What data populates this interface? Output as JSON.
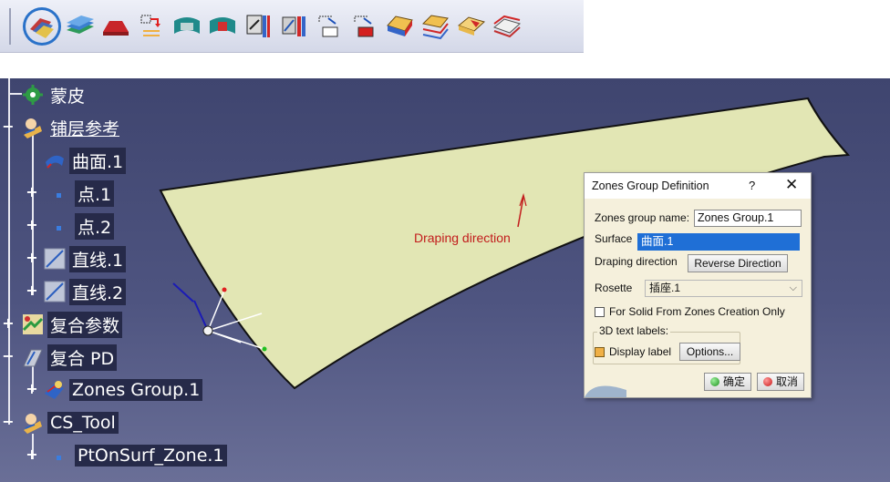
{
  "toolbar": {
    "icons": [
      "composites-design-icon",
      "layered-plies-icon",
      "stacking-icon",
      "transfer-icon",
      "zone-group-icon",
      "zone-icon",
      "rosette-icon",
      "ply-group-icon",
      "copy-plies-icon",
      "paste-plies-icon",
      "solid-slicing-icon",
      "explode-plies-icon",
      "core-sampling-icon",
      "export-plies-icon"
    ],
    "active_index": 0
  },
  "tree": {
    "items": [
      {
        "label": "蒙皮",
        "icon": "gear-settings-icon"
      },
      {
        "label": "铺层参考",
        "icon": "reference-icon",
        "underlined": true
      },
      {
        "label": "曲面.1",
        "icon": "surface-icon"
      },
      {
        "label": "点.1",
        "icon": "point-icon"
      },
      {
        "label": "点.2",
        "icon": "point-icon"
      },
      {
        "label": "直线.1",
        "icon": "line-icon"
      },
      {
        "label": "直线.2",
        "icon": "line-icon"
      },
      {
        "label": "复合参数",
        "icon": "composites-parameters-icon"
      },
      {
        "label": "复合 PD",
        "icon": "composites-pd-icon"
      },
      {
        "label": "Zones Group.1",
        "icon": "zones-group-icon"
      },
      {
        "label": "CS_Tool",
        "icon": "reference-icon"
      },
      {
        "label": "PtOnSurf_Zone.1",
        "icon": "point-icon"
      }
    ]
  },
  "viewport": {
    "draping_label": "Draping direction"
  },
  "dialog": {
    "title": "Zones Group Definition",
    "help": "?",
    "close": "✕",
    "zones_group_name_label": "Zones group name:",
    "zones_group_name_value": "Zones Group.1",
    "surface_label": "Surface",
    "surface_value": "曲面.1",
    "draping_direction_label": "Draping direction",
    "reverse_direction_button": "Reverse Direction",
    "rosette_label": "Rosette",
    "rosette_value": "插座.1",
    "solid_checkbox_label": "For Solid From Zones Creation Only",
    "solid_checkbox_checked": false,
    "text_labels_group": "3D text labels:",
    "display_label": "Display label",
    "display_label_checked": true,
    "options_button": "Options...",
    "ok_button": "确定",
    "cancel_button": "取消"
  }
}
